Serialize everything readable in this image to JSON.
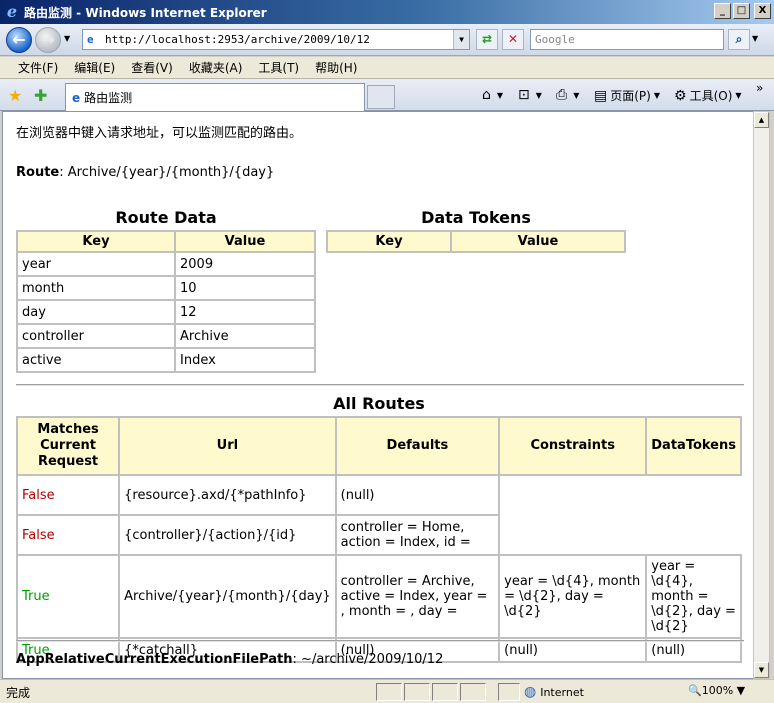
{
  "window": {
    "title": "路由监测 - Windows Internet Explorer",
    "min_glyph": "_",
    "max_glyph": "□",
    "close_glyph": "X"
  },
  "address": {
    "url": "http://localhost:2953/archive/2009/10/12",
    "search_placeholder": "Google"
  },
  "menu": [
    "文件(F)",
    "编辑(E)",
    "查看(V)",
    "收藏夹(A)",
    "工具(T)",
    "帮助(H)"
  ],
  "tab": {
    "label": "路由监测"
  },
  "commands": {
    "page_label": "页面(P)",
    "tools_label": "工具(O)"
  },
  "page": {
    "intro": "在浏览器中键入请求地址，可以监测匹配的路由。",
    "route_label": "Route",
    "route_value": "Archive/{year}/{month}/{day}",
    "route_data": {
      "title": "Route Data",
      "headers": [
        "Key",
        "Value"
      ],
      "rows": [
        [
          "year",
          "2009"
        ],
        [
          "month",
          "10"
        ],
        [
          "day",
          "12"
        ],
        [
          "controller",
          "Archive"
        ],
        [
          "active",
          "Index"
        ]
      ]
    },
    "data_tokens": {
      "title": "Data Tokens",
      "headers": [
        "Key",
        "Value"
      ]
    },
    "all_routes": {
      "title": "All Routes",
      "headers": [
        "Matches Current Request",
        "Url",
        "Defaults",
        "Constraints",
        "DataTokens"
      ],
      "rows": [
        {
          "match": "False",
          "url": "{resource}.axd/{*pathInfo}",
          "defaults": "(null)",
          "constraints": "",
          "tokens": ""
        },
        {
          "match": "False",
          "url": "{controller}/{action}/{id}",
          "defaults": "controller = Home, action = Index, id =",
          "constraints": "",
          "tokens": ""
        },
        {
          "match": "True",
          "url": "Archive/{year}/{month}/{day}",
          "defaults": "controller = Archive, active = Index, year = , month = , day =",
          "constraints": "year = \\d{4}, month = \\d{2}, day = \\d{2}",
          "tokens": "year = \\d{4}, month = \\d{2}, day = \\d{2}"
        },
        {
          "match": "True",
          "url": "{*catchall}",
          "defaults": "(null)",
          "constraints": "(null)",
          "tokens": "(null)"
        }
      ]
    },
    "exec_label": "AppRelativeCurrentExecutionFilePath",
    "exec_value": "~/archive/2009/10/12"
  },
  "status": {
    "text": "完成",
    "zone": "Internet",
    "zoom": "100%"
  }
}
